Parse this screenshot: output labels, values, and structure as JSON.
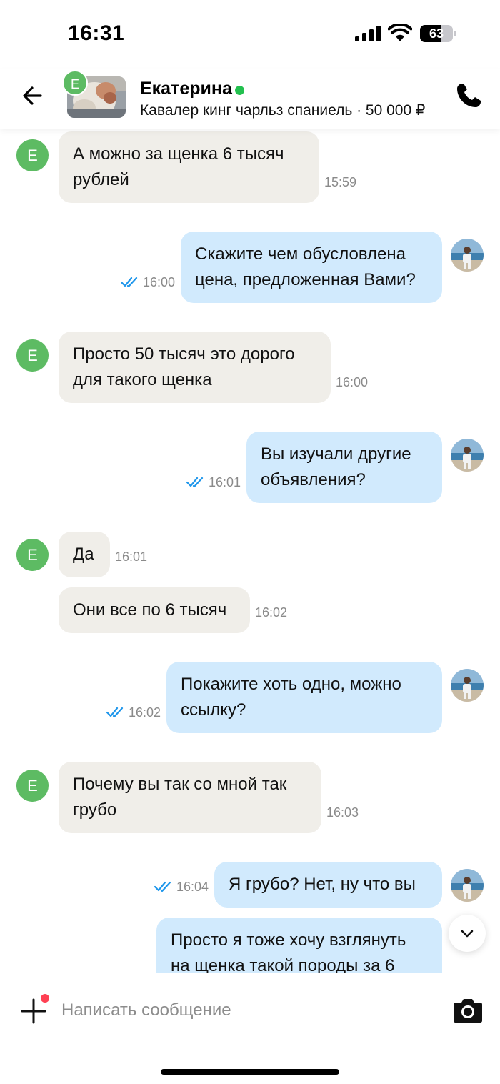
{
  "status_bar": {
    "time": "16:31",
    "battery": "63",
    "battery_level": 0.63
  },
  "header": {
    "contact_name": "Екатерина",
    "avatar_letter": "E",
    "listing": "Кавалер кинг чарльз спаниель · 50 000 ₽",
    "online": true
  },
  "messages": [
    {
      "dir": "in",
      "text": "А можно за щенка 6 тысяч\nрублей",
      "time": "15:59"
    },
    {
      "dir": "out",
      "text": "Скажите чем обусловлена\nцена, предложенная Вами?",
      "time": "16:00",
      "read": true
    },
    {
      "dir": "in",
      "text": "Просто 50 тысяч это дорого\nдля такого щенка",
      "time": "16:00"
    },
    {
      "dir": "out",
      "text": "Вы изучали другие\nобъявления?",
      "time": "16:01",
      "read": true
    },
    {
      "dir": "in",
      "text": "Да",
      "time": "16:01"
    },
    {
      "dir": "in",
      "text": "Они все по 6 тысяч",
      "time": "16:02"
    },
    {
      "dir": "out",
      "text": "Покажите хоть одно, можно\nссылку?",
      "time": "16:02",
      "read": true
    },
    {
      "dir": "in",
      "text": "Почему вы так со мной так\nгрубо",
      "time": "16:03"
    },
    {
      "dir": "out",
      "text": "Я грубо? Нет, ну что вы",
      "time": "16:04",
      "read": true
    },
    {
      "dir": "out",
      "text": "Просто я тоже хочу взглянуть\nна щенка такой породы за 6",
      "time": ""
    }
  ],
  "composer": {
    "placeholder": "Написать сообщение"
  },
  "colors": {
    "incoming_bubble": "#f0eee9",
    "outgoing_bubble": "#d1eafd",
    "avatar_green": "#5dbb63",
    "online_green": "#23c04f",
    "read_check": "#1e96eb",
    "badge_red": "#ff4053"
  },
  "icons": [
    "back-arrow-icon",
    "phone-icon",
    "double-check-icon",
    "chevron-down-icon",
    "plus-icon",
    "camera-icon"
  ]
}
